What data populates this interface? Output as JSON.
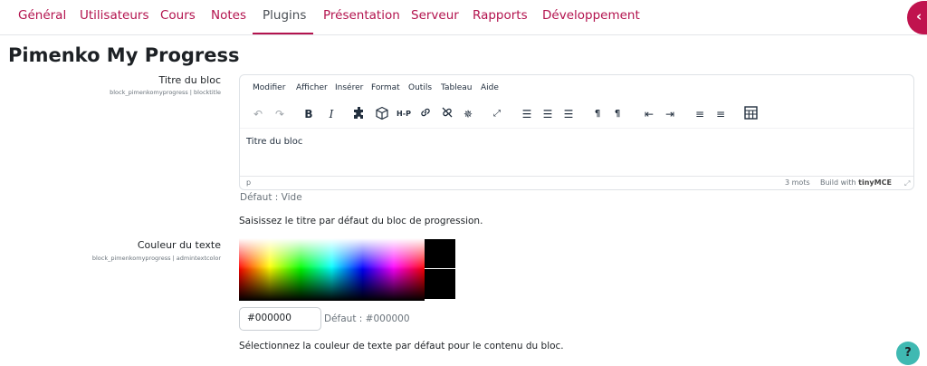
{
  "nav": {
    "tabs": [
      "Général",
      "Utilisateurs",
      "Cours",
      "Notes",
      "Plugins",
      "Présentation",
      "Serveur",
      "Rapports",
      "Développement"
    ],
    "active_tab": "Plugins"
  },
  "drawer_icon": "chevron-left-icon",
  "page_title": "Pimenko My Progress",
  "block_title_setting": {
    "label": "Titre du bloc",
    "key": "block_pimenkomyprogress | blocktitle",
    "editor": {
      "menus": [
        "Modifier",
        "Afficher",
        "Insérer",
        "Format",
        "Outils",
        "Tableau",
        "Aide"
      ],
      "toolbar_icons": [
        "undo-icon",
        "redo-icon",
        "bold-icon",
        "italic-icon",
        "puzzle-icon",
        "cube-icon",
        "h5p-icon",
        "link-icon",
        "unlink-icon",
        "sparkle-icon",
        "fullscreen-icon",
        "align-left-icon",
        "align-center-icon",
        "align-right-icon",
        "ltr-icon",
        "rtl-icon",
        "outdent-icon",
        "indent-icon",
        "bullet-list-icon",
        "numbered-list-icon",
        "table-icon"
      ],
      "bold_label": "B",
      "italic_label": "I",
      "h5p_label": "H-P",
      "content": "Titre du bloc",
      "path": "p",
      "word_count": "3 mots",
      "build_with": "Build with",
      "brand": "tinyMCE"
    },
    "default": "Défaut : Vide",
    "description": "Saisissez le titre par défaut du bloc de progression."
  },
  "text_color_setting": {
    "label": "Couleur du texte",
    "key": "block_pimenkomyprogress | admintextcolor",
    "value": "#000000",
    "preview_color": "#000000",
    "default": "Défaut : #000000",
    "description": "Sélectionnez la couleur de texte par défaut pour le contenu du bloc."
  },
  "help_label": "?",
  "colors": {
    "accent": "#b3134e",
    "drawer": "#c0134e",
    "help": "#3fb9b2"
  }
}
